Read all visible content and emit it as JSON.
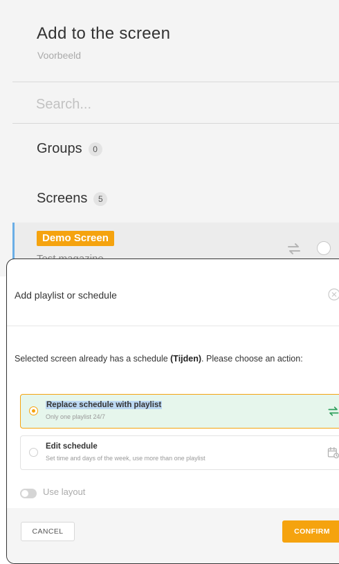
{
  "panel": {
    "title": "Add to the screen",
    "subtitle": "Voorbeeld",
    "search_placeholder": "Search...",
    "groups": {
      "label": "Groups",
      "count": "0"
    },
    "screens": {
      "label": "Screens",
      "count": "5"
    },
    "screen_item": {
      "name": "Demo Screen",
      "playlist": "Test magazine",
      "icon": "repeat-icon",
      "selected": false
    }
  },
  "modal": {
    "title": "Add playlist or schedule",
    "message_prefix": "Selected screen already has a schedule ",
    "schedule_name": "(Tijden)",
    "message_suffix": ". Please choose an action:",
    "options": [
      {
        "title": "Replace schedule with playlist",
        "description": "Only one playlist 24/7",
        "icon": "repeat-icon",
        "selected": true
      },
      {
        "title": "Edit schedule",
        "description": "Set time and days of the week, use more than one playlist",
        "icon": "calendar-clock-icon",
        "selected": false
      }
    ],
    "toggle": {
      "label": "Use layout",
      "on": false
    },
    "cancel_label": "CANCEL",
    "confirm_label": "CONFIRM"
  },
  "colors": {
    "accent_orange": "#f5a30f",
    "selected_bg": "#e6f6ec",
    "repeat_green": "#2e9e5b",
    "row_accent": "#6aaee6"
  }
}
